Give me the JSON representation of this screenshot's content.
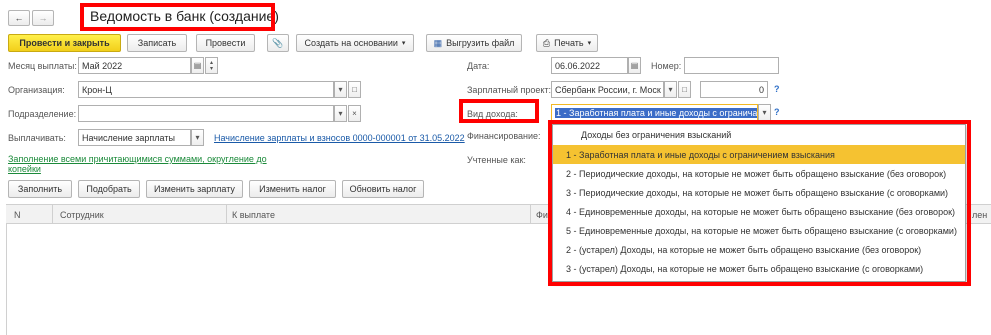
{
  "window": {
    "title": "Ведомость в банк (создание)",
    "nav_back_icon": "arrow-left-icon",
    "nav_forward_icon": "arrow-right-icon"
  },
  "toolbar": {
    "post_close_label": "Провести и закрыть",
    "save_label": "Записать",
    "post_label": "Провести",
    "based_on_label": "Создать на основании",
    "export_label": "Выгрузить файл",
    "print_label": "Печать"
  },
  "form": {
    "month_label": "Месяц выплаты:",
    "month_value": "Май 2022",
    "org_label": "Организация:",
    "org_value": "Крон-Ц",
    "dept_label": "Подразделение:",
    "dept_value": "",
    "pay_label": "Выплачивать:",
    "pay_value": "Начисление зарплаты",
    "pay_link": "Начисление зарплаты и взносов 0000-000001 от 31.05.2022",
    "fill_link": "Заполнение всеми причитающимися суммами, округление до копейки",
    "date_label": "Дата:",
    "date_value": "06.06.2022",
    "number_label": "Номер:",
    "number_value": "",
    "salary_project_label": "Зарплатный проект:",
    "salary_project_value": "Сбербанк России, г. Моск",
    "amount_value": "0",
    "help_mark": "?",
    "income_type_label": "Вид дохода:",
    "income_type_value": "1 - Заработная плата и иные доходы с огранича",
    "financing_label": "Финансирование:",
    "accounted_label": "Учтенные как:"
  },
  "table_toolbar": {
    "fill_label": "Заполнить",
    "pick_label": "Подобрать",
    "change_salary_label": "Изменить зарплату",
    "change_tax_label": "Изменить налог",
    "refresh_tax_label": "Обновить налог"
  },
  "table": {
    "columns": [
      "N",
      "Сотрудник",
      "К выплате",
      "Фи",
      "лен"
    ]
  },
  "dropdown": {
    "items": [
      "Доходы без ограничения взысканий",
      "1 - Заработная плата и иные доходы с ограничением взыскания",
      "2 - Периодические доходы, на которые не может быть обращено взыскание (без оговорок)",
      "3 - Периодические доходы, на которые не может быть обращено взыскание (с оговорками)",
      "4 - Единовременные доходы, на которые не может быть обращено взыскание (без оговорок)",
      "5 - Единовременные доходы, на которые не может быть обращено взыскание (с оговорками)",
      "2 - (устарел) Доходы, на которые не может быть обращено взыскание (без оговорок)",
      "3 - (устарел) Доходы, на которые не может быть обращено взыскание (с оговорками)"
    ],
    "selected_index": 1
  },
  "colors": {
    "accent_yellow": "#f5c231",
    "highlight_red": "#ff0000",
    "link_blue": "#1a5aa8",
    "link_green": "#1b8a3a"
  }
}
